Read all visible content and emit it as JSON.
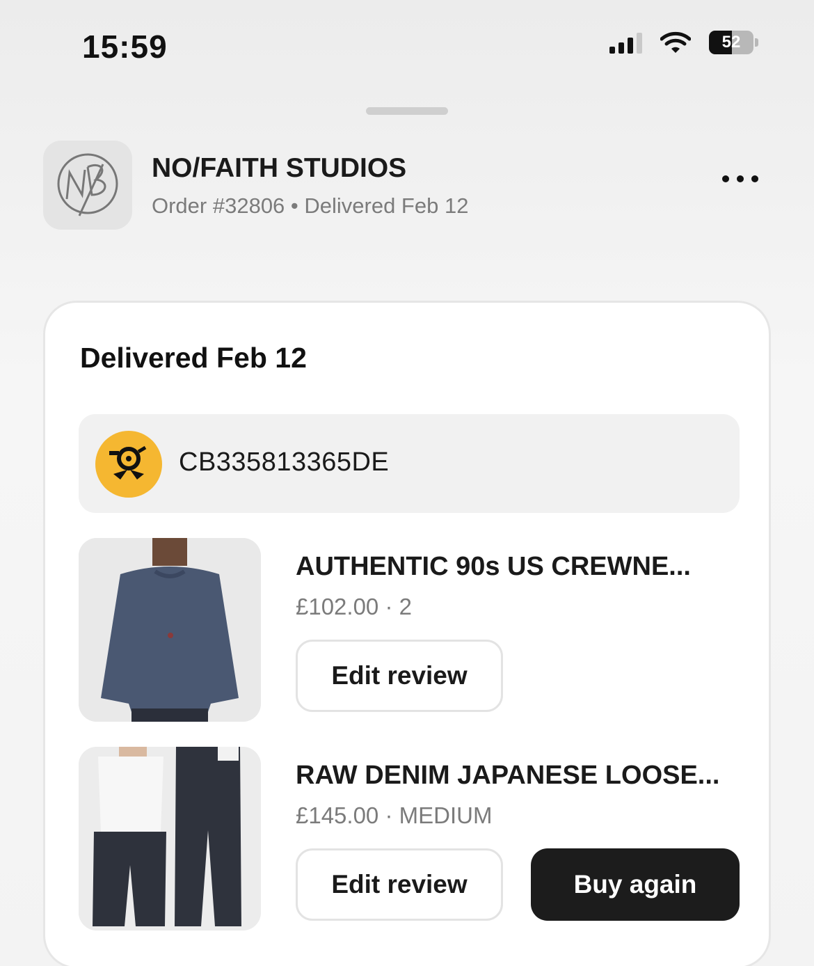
{
  "status_bar": {
    "time": "15:59",
    "battery_percent": "52",
    "battery_level": 0.52
  },
  "store": {
    "name": "NO/FAITH STUDIOS",
    "order_meta": "Order #32806 • Delivered Feb 12",
    "logo_icon": "nofaith-monogram-logo",
    "more_icon": "more-horizontal-icon"
  },
  "delivery": {
    "title": "Delivered Feb 12",
    "tracking_number": "CB335813365DE",
    "carrier_icon": "deutsche-post-horn-icon",
    "carrier_color": "#f5b731"
  },
  "items": [
    {
      "title": "AUTHENTIC 90s US CREWNE...",
      "meta": "£102.00 · 2",
      "image": "navy-crewneck-sweatshirt-photo",
      "edit_label": "Edit review"
    },
    {
      "title": "RAW DENIM JAPANESE LOOSE...",
      "meta": "£145.00 · MEDIUM",
      "image": "loose-raw-denim-jeans-photo",
      "edit_label": "Edit review",
      "buy_label": "Buy again"
    }
  ],
  "colors": {
    "primary_button": "#1c1c1c",
    "card_bg": "#ffffff",
    "muted_text": "#7b7b7b"
  }
}
